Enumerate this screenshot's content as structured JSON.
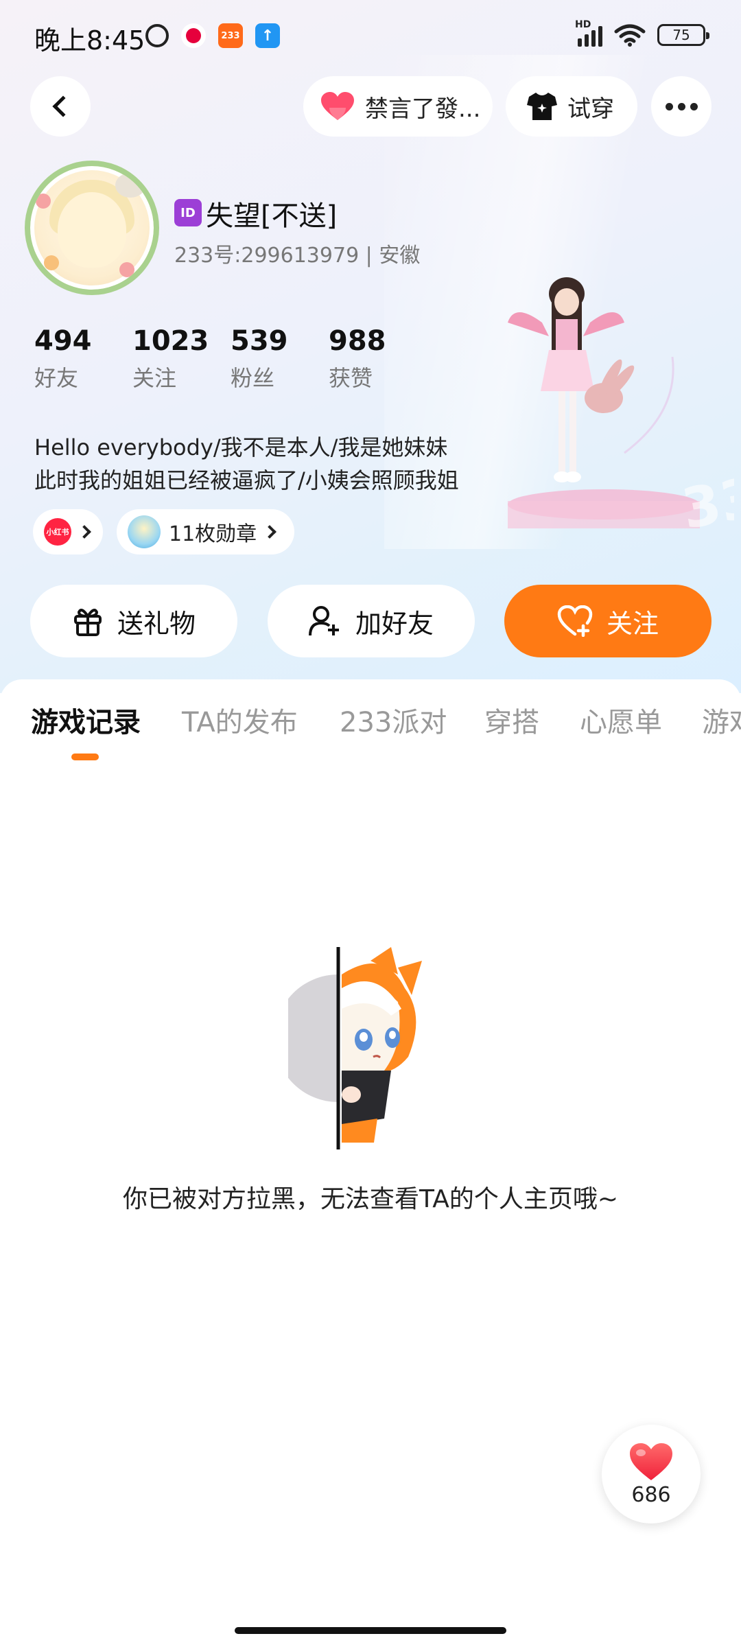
{
  "status_bar": {
    "time": "晚上8:45",
    "app_icon_233": "233",
    "network_label": "HD",
    "battery": "75"
  },
  "top_nav": {
    "mute_label": "禁言了發...",
    "try_on_label": "试穿"
  },
  "profile": {
    "badge": "ID",
    "username": "失望[不送]",
    "meta": "233号:299613979 | 安徽",
    "stats": [
      {
        "value": "494",
        "label": "好友"
      },
      {
        "value": "1023",
        "label": "关注"
      },
      {
        "value": "539",
        "label": "粉丝"
      },
      {
        "value": "988",
        "label": "获赞"
      }
    ],
    "bio_line1": "Hello everybody/我不是本人/我是她妹妹",
    "bio_line2": "此时我的姐姐已经被逼疯了/小姨会照顾我姐",
    "xhs_icon_text": "小红书",
    "medal_label": "11枚勋章"
  },
  "actions": {
    "gift_label": "送礼物",
    "add_friend_label": "加好友",
    "follow_label": "关注"
  },
  "tabs": [
    "游戏记录",
    "TA的发布",
    "233派对",
    "穿搭",
    "心愿单",
    "游戏"
  ],
  "empty_state": {
    "message": "你已被对方拉黑，无法查看TA的个人主页哦~"
  },
  "like_float": {
    "count": "686"
  },
  "colors": {
    "accent": "#ff7a14",
    "heart": "#ff3b4f",
    "id_badge": "#9c3fd6"
  }
}
